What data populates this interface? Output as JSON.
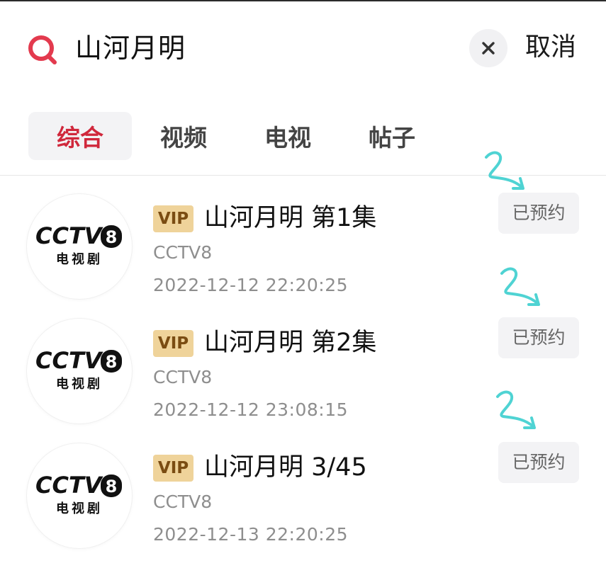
{
  "search": {
    "query": "山河月明",
    "cancel_label": "取消"
  },
  "tabs": [
    {
      "label": "综合",
      "active": true
    },
    {
      "label": "视频",
      "active": false
    },
    {
      "label": "电视",
      "active": false
    },
    {
      "label": "帖子",
      "active": false
    }
  ],
  "results": [
    {
      "badge": "VIP",
      "title": "山河月明 第1集",
      "channel": "CCTV8",
      "time": "2022-12-12 22:20:25",
      "logo_text": "CCTV",
      "logo_number": "8",
      "logo_subtitle": "电视剧",
      "action_label": "已预约"
    },
    {
      "badge": "VIP",
      "title": "山河月明 第2集",
      "channel": "CCTV8",
      "time": "2022-12-12 23:08:15",
      "logo_text": "CCTV",
      "logo_number": "8",
      "logo_subtitle": "电视剧",
      "action_label": "已预约"
    },
    {
      "badge": "VIP",
      "title": "山河月明 3/45",
      "channel": "CCTV8",
      "time": "2022-12-13 22:20:25",
      "logo_text": "CCTV",
      "logo_number": "8",
      "logo_subtitle": "电视剧",
      "action_label": "已预约"
    }
  ],
  "colors": {
    "accent": "#d0283c",
    "vip_badge": "#efd39a",
    "annotation_arrow": "#4fd3d3"
  },
  "icons": {
    "search": "search-icon",
    "clear": "close-icon",
    "annotation": "hand-drawn-arrow-icon"
  }
}
